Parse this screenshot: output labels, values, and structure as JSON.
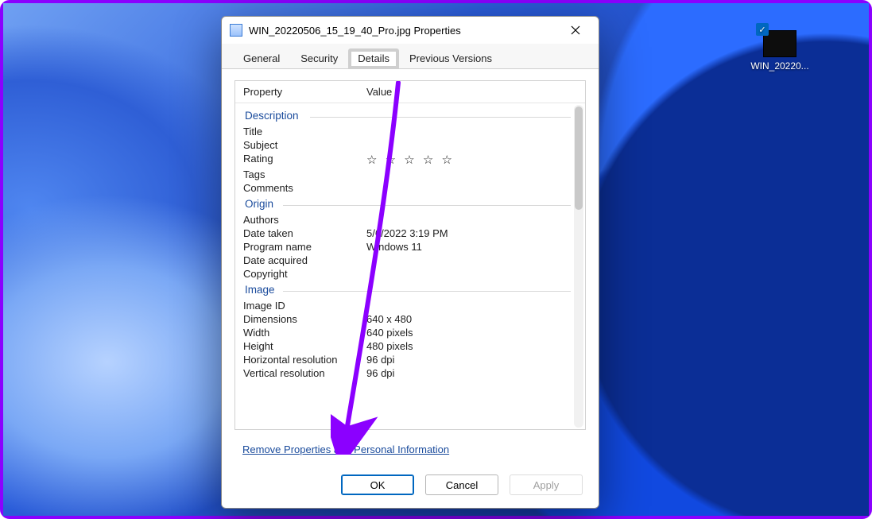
{
  "desktop": {
    "file_label": "WIN_20220..."
  },
  "dialog": {
    "title": "WIN_20220506_15_19_40_Pro.jpg Properties",
    "tabs": [
      "General",
      "Security",
      "Details",
      "Previous Versions"
    ],
    "active_tab": "Details",
    "columns": {
      "property": "Property",
      "value": "Value"
    },
    "sections": [
      {
        "title": "Description",
        "rows": [
          {
            "property": "Title",
            "value": ""
          },
          {
            "property": "Subject",
            "value": ""
          },
          {
            "property": "Rating",
            "value": "☆ ☆ ☆ ☆ ☆",
            "is_stars": true
          },
          {
            "property": "Tags",
            "value": ""
          },
          {
            "property": "Comments",
            "value": ""
          }
        ]
      },
      {
        "title": "Origin",
        "rows": [
          {
            "property": "Authors",
            "value": ""
          },
          {
            "property": "Date taken",
            "value": "5/6/2022 3:19 PM"
          },
          {
            "property": "Program name",
            "value": "Windows 11"
          },
          {
            "property": "Date acquired",
            "value": ""
          },
          {
            "property": "Copyright",
            "value": ""
          }
        ]
      },
      {
        "title": "Image",
        "rows": [
          {
            "property": "Image ID",
            "value": ""
          },
          {
            "property": "Dimensions",
            "value": "640 x 480"
          },
          {
            "property": "Width",
            "value": "640 pixels"
          },
          {
            "property": "Height",
            "value": "480 pixels"
          },
          {
            "property": "Horizontal resolution",
            "value": "96 dpi"
          },
          {
            "property": "Vertical resolution",
            "value": "96 dpi"
          }
        ]
      }
    ],
    "remove_link": "Remove Properties and Personal Information",
    "buttons": {
      "ok": "OK",
      "cancel": "Cancel",
      "apply": "Apply"
    }
  }
}
